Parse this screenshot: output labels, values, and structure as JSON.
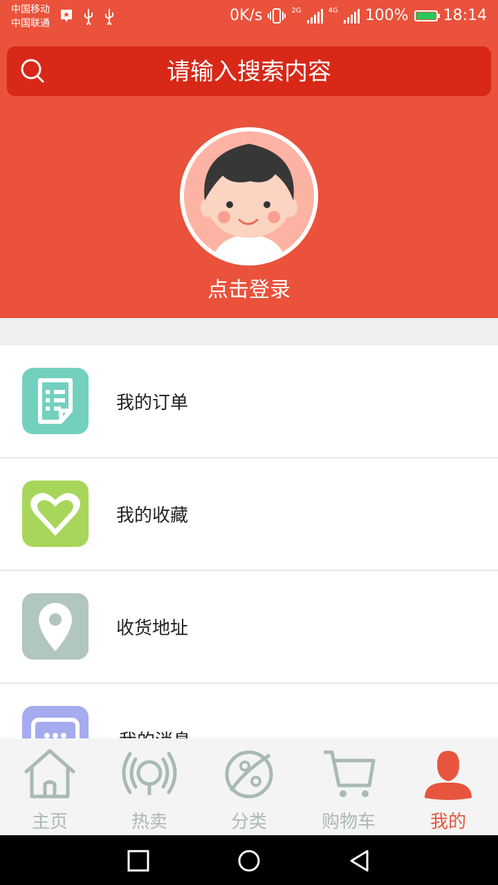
{
  "status_bar": {
    "carrier_1": "中国移动",
    "carrier_2": "中国联通",
    "speed": "0K/s",
    "net_2g": "2G",
    "net_4g": "4G",
    "battery": "100%",
    "time": "18:14"
  },
  "search": {
    "placeholder": "请输入搜索内容"
  },
  "profile": {
    "login_label": "点击登录"
  },
  "menu": {
    "items": [
      {
        "label": "我的订单",
        "icon": "order-icon",
        "color": "#74d0be"
      },
      {
        "label": "我的收藏",
        "icon": "heart-icon",
        "color": "#a8d65a"
      },
      {
        "label": "收货地址",
        "icon": "location-pin-icon",
        "color": "#b1c5c1"
      },
      {
        "label": "我的消息",
        "icon": "message-icon",
        "color": "#a4abef"
      }
    ]
  },
  "tabbar": {
    "items": [
      {
        "label": "主页",
        "icon": "home-icon"
      },
      {
        "label": "热卖",
        "icon": "hot-icon"
      },
      {
        "label": "分类",
        "icon": "category-icon"
      },
      {
        "label": "购物车",
        "icon": "cart-icon"
      },
      {
        "label": "我的",
        "icon": "user-icon",
        "active": true
      }
    ],
    "active_color": "#e8553e",
    "inactive_color": "#a9b9b5"
  },
  "colors": {
    "header_red": "#ea523b",
    "search_red": "#d82818"
  }
}
